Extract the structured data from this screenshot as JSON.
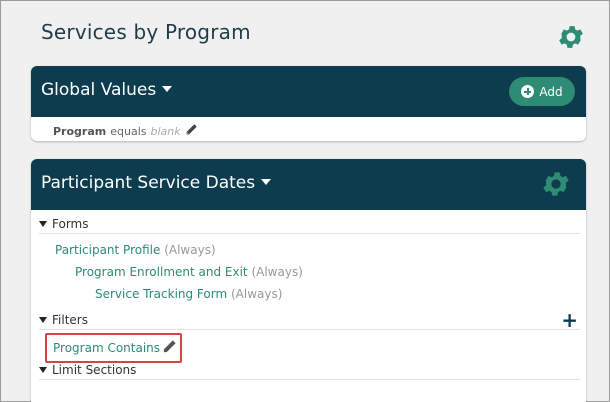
{
  "page": {
    "title": "Services by Program"
  },
  "global_values": {
    "title": "Global Values",
    "add_label": "Add",
    "condition": {
      "field": "Program",
      "operator": "equals",
      "value": "blank"
    }
  },
  "participant_service_dates": {
    "title": "Participant Service Dates",
    "forms_label": "Forms",
    "forms": [
      {
        "name": "Participant Profile",
        "mode": "(Always)"
      },
      {
        "name": "Program Enrollment and Exit",
        "mode": "(Always)"
      },
      {
        "name": "Service Tracking Form",
        "mode": "(Always)"
      }
    ],
    "filters_label": "Filters",
    "filters": [
      {
        "name": "Program Contains"
      }
    ],
    "limit_sections_label": "Limit Sections"
  },
  "colors": {
    "header_bg": "#0d3c4e",
    "accent": "#2e8b74",
    "highlight": "#d64545"
  },
  "icons": [
    "gear-icon",
    "caret-down-icon",
    "plus-circle-icon",
    "pencil-icon",
    "triangle-down-icon",
    "plus-icon"
  ]
}
